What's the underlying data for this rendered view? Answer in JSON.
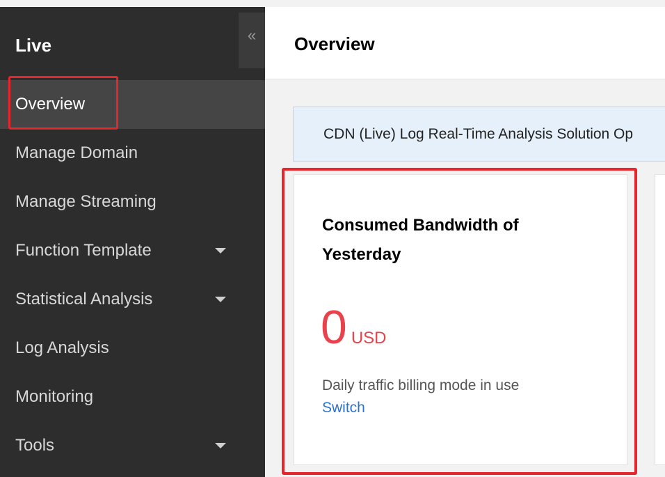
{
  "sidebar": {
    "title": "Live",
    "collapse_glyph": "«",
    "items": [
      {
        "label": "Overview",
        "active": true,
        "has_caret": false
      },
      {
        "label": "Manage Domain",
        "has_caret": false
      },
      {
        "label": "Manage Streaming",
        "has_caret": false
      },
      {
        "label": "Function Template",
        "has_caret": true
      },
      {
        "label": "Statistical Analysis",
        "has_caret": true
      },
      {
        "label": "Log Analysis",
        "has_caret": false
      },
      {
        "label": "Monitoring",
        "has_caret": false
      },
      {
        "label": "Tools",
        "has_caret": true
      }
    ]
  },
  "header": {
    "title": "Overview"
  },
  "banner": {
    "text": "CDN (Live) Log Real-Time Analysis Solution Op"
  },
  "card": {
    "title": "Consumed Bandwidth of Yesterday",
    "value": "0",
    "unit": "USD",
    "note": "Daily traffic billing mode in use",
    "link": "Switch"
  },
  "colors": {
    "highlight": "#e6262d",
    "metric": "#e8434d",
    "link": "#2a73d2",
    "sidebar_bg": "#2d2d2d"
  }
}
